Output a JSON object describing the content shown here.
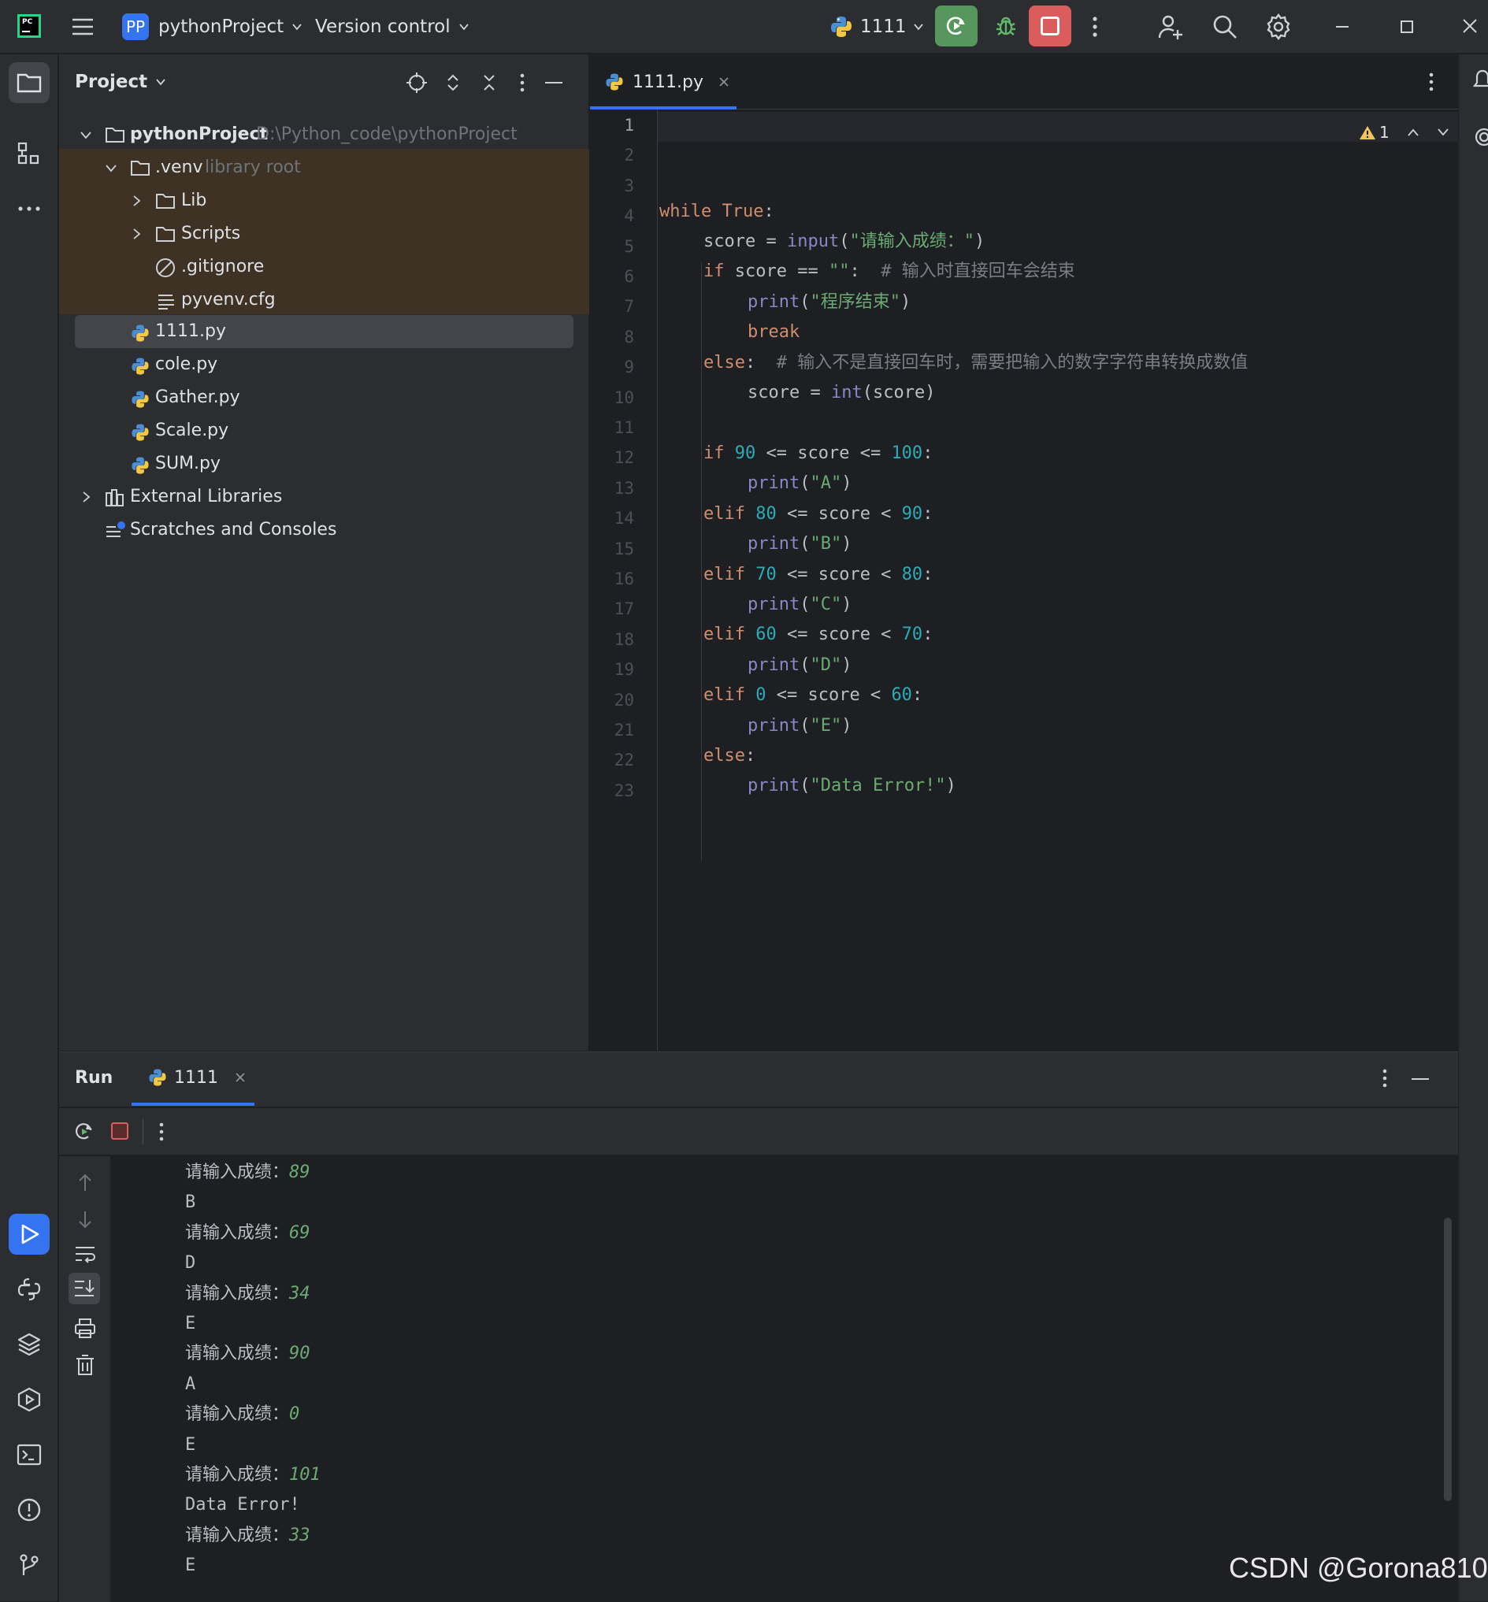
{
  "titlebar": {
    "project_badge": "PP",
    "project_name": "pythonProject",
    "version_control": "Version control",
    "run_config": "1111"
  },
  "project_panel": {
    "title": "Project",
    "tree": [
      {
        "label": "pythonProject",
        "hint": "D:\\Python_code\\pythonProject"
      },
      {
        "label": ".venv",
        "hint": "library root"
      },
      {
        "label": "Lib"
      },
      {
        "label": "Scripts"
      },
      {
        "label": ".gitignore"
      },
      {
        "label": "pyvenv.cfg"
      },
      {
        "label": "1111.py"
      },
      {
        "label": "cole.py"
      },
      {
        "label": "Gather.py"
      },
      {
        "label": "Scale.py"
      },
      {
        "label": "SUM.py"
      },
      {
        "label": "External Libraries"
      },
      {
        "label": "Scratches and Consoles"
      }
    ]
  },
  "editor": {
    "tab_label": "1111.py",
    "warning_count": "1",
    "line_numbers": [
      "1",
      "2",
      "3",
      "4",
      "5",
      "6",
      "7",
      "8",
      "9",
      "10",
      "11",
      "12",
      "13",
      "14",
      "15",
      "16",
      "17",
      "18",
      "19",
      "20",
      "21",
      "22",
      "23"
    ],
    "code": {
      "l2_kw": "while True",
      "l2_colon": ":",
      "l3_a": "score = ",
      "l3_fn": "input",
      "l3_str": "\"请输入成绩：\"",
      "l4_kw": "if",
      "l4_a": " score == ",
      "l4_str": "\"\"",
      "l4_b": ":  ",
      "l4_cmt": "# 输入时直接回车会结束",
      "l5_fn": "print",
      "l5_str": "\"程序结束\"",
      "l6_kw": "break",
      "l7_kw": "else",
      "l7_b": ":  ",
      "l7_cmt": "# 输入不是直接回车时，需要把输入的数字字符串转换成数值",
      "l8_a": "score = ",
      "l8_fn": "int",
      "l8_b": "(score)",
      "l10_kw": "if",
      "l10_n1": "90",
      "l10_a": " <= score <= ",
      "l10_n2": "100",
      "l11_str": "\"A\"",
      "l12_kw": "elif",
      "l12_n1": "80",
      "l12_a": " <= score < ",
      "l12_n2": "90",
      "l13_str": "\"B\"",
      "l14_n1": "70",
      "l14_n2": "80",
      "l15_str": "\"C\"",
      "l16_n1": "60",
      "l16_n2": "70",
      "l17_str": "\"D\"",
      "l18_n1": "0",
      "l18_n2": "60",
      "l19_str": "\"E\"",
      "l20_kw": "else",
      "l21_str": "\"Data Error!\""
    }
  },
  "run_panel": {
    "title": "Run",
    "tab_label": "1111",
    "output": [
      {
        "prompt": "请输入成绩：",
        "input": "89"
      },
      {
        "text": "B"
      },
      {
        "prompt": "请输入成绩：",
        "input": "69"
      },
      {
        "text": "D"
      },
      {
        "prompt": "请输入成绩：",
        "input": "34"
      },
      {
        "text": "E"
      },
      {
        "prompt": "请输入成绩：",
        "input": "90"
      },
      {
        "text": "A"
      },
      {
        "prompt": "请输入成绩：",
        "input": "0"
      },
      {
        "text": "E"
      },
      {
        "prompt": "请输入成绩：",
        "input": "101"
      },
      {
        "text": "Data Error!"
      },
      {
        "prompt": "请输入成绩：",
        "input": "33"
      },
      {
        "text": "E"
      }
    ]
  },
  "watermark": "CSDN @Gorona810",
  "colors": {
    "accent": "#3574f0",
    "run_green": "#57965c",
    "stop_red": "#db5c5c",
    "keyword": "#cf8e6d",
    "string": "#6aab73",
    "number": "#2aacb8",
    "comment": "#7a7e85"
  }
}
